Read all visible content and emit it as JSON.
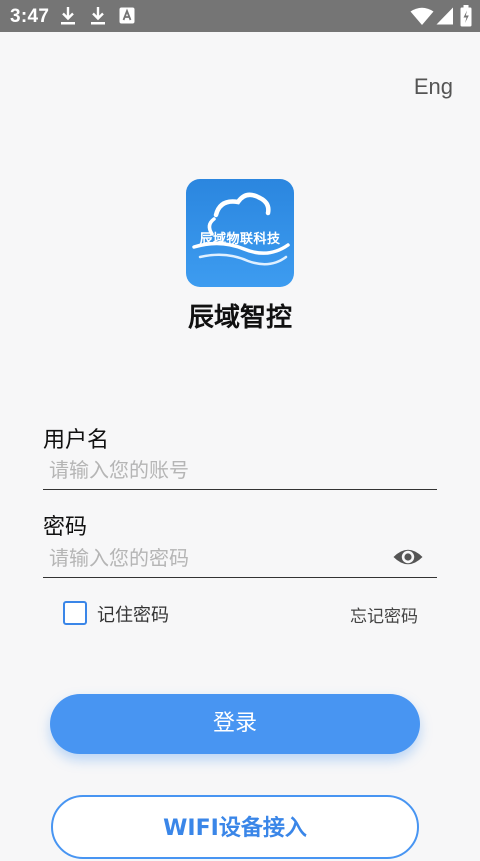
{
  "status_bar": {
    "time": "3:47",
    "icons": [
      "download-icon",
      "download-icon",
      "a-notification-icon",
      "wifi-icon",
      "signal-icon",
      "battery-charging-icon"
    ]
  },
  "header": {
    "language_toggle": "Eng"
  },
  "app": {
    "logo_text": "辰域物联科技",
    "name": "辰域智控"
  },
  "form": {
    "username": {
      "label": "用户名",
      "placeholder": "请输入您的账号",
      "value": ""
    },
    "password": {
      "label": "密码",
      "placeholder": "请输入您的密码",
      "value": ""
    },
    "remember_label": "记住密码",
    "remember_checked": false,
    "forgot_label": "忘记密码"
  },
  "actions": {
    "login_label": "登录",
    "wifi_label": "WIFI设备接入"
  },
  "colors": {
    "accent": "#4895f2",
    "status_bar": "#757575",
    "background": "#f7f7f8",
    "logo_background": "#2f8ee6"
  }
}
